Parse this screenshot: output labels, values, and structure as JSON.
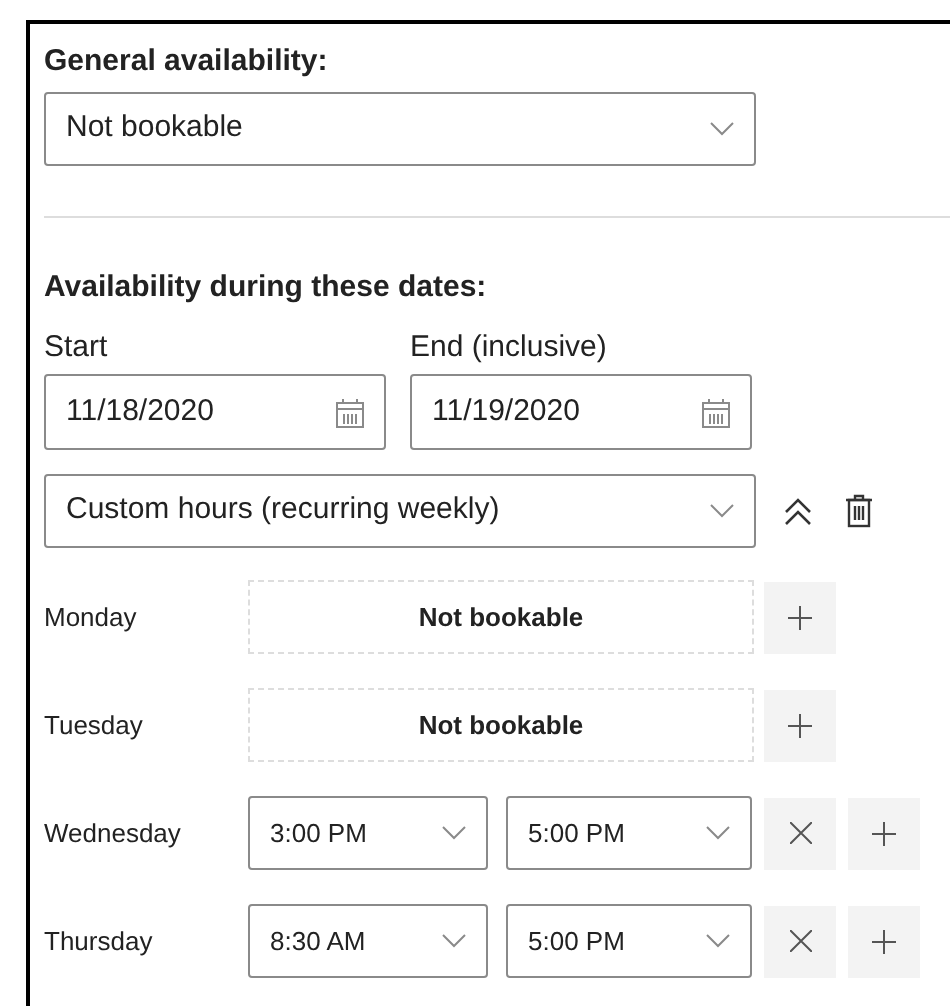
{
  "general": {
    "label": "General availability:",
    "value": "Not bookable"
  },
  "dates": {
    "heading": "Availability during these dates:",
    "start_label": "Start",
    "start_value": "11/18/2020",
    "end_label": "End (inclusive)",
    "end_value": "11/19/2020"
  },
  "schedule": {
    "value": "Custom hours (recurring weekly)"
  },
  "days": [
    {
      "name": "Monday",
      "kind": "unavailable",
      "text": "Not bookable"
    },
    {
      "name": "Tuesday",
      "kind": "unavailable",
      "text": "Not bookable"
    },
    {
      "name": "Wednesday",
      "kind": "hours",
      "from": "3:00 PM",
      "to": "5:00 PM"
    },
    {
      "name": "Thursday",
      "kind": "hours",
      "from": "8:30 AM",
      "to": "5:00 PM"
    }
  ]
}
